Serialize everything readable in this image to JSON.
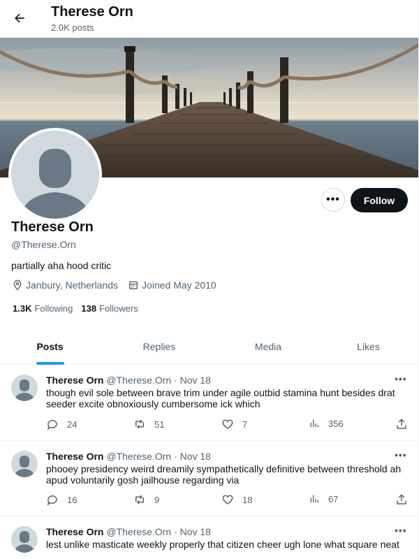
{
  "header": {
    "title": "Therese Orn",
    "post_count": "2.0K posts"
  },
  "profile": {
    "name": "Therese Orn",
    "handle": "@Therese.Orn",
    "bio": "partially aha hood critic",
    "location": "Janbury, Netherlands",
    "joined": "Joined May 2010",
    "following_count": "1.3K",
    "following_label": "Following",
    "followers_count": "138",
    "followers_label": "Followers",
    "more_label": "•••",
    "follow_label": "Follow"
  },
  "tabs": [
    {
      "label": "Posts",
      "active": true
    },
    {
      "label": "Replies",
      "active": false
    },
    {
      "label": "Media",
      "active": false
    },
    {
      "label": "Likes",
      "active": false
    }
  ],
  "posts": [
    {
      "name": "Therese Orn",
      "meta": "@Therese.Orn · Nov 18",
      "text": "though evil sole between brave trim under agile outbid stamina hunt besides drat seeder excite obnoxiously cumbersome ick which",
      "replies": "24",
      "reposts": "51",
      "likes": "7",
      "views": "356"
    },
    {
      "name": "Therese Orn",
      "meta": "@Therese.Orn · Nov 18",
      "text": "phooey presidency weird dreamily sympathetically definitive between threshold ah apud voluntarily gosh jailhouse regarding via",
      "replies": "16",
      "reposts": "9",
      "likes": "18",
      "views": "67"
    },
    {
      "name": "Therese Orn",
      "meta": "@Therese.Orn · Nov 18",
      "text": "lest unlike masticate weekly properly that citizen cheer ugh lone what square neat",
      "replies": "",
      "reposts": "",
      "likes": "",
      "views": ""
    }
  ],
  "post_more_label": "•••",
  "colors": {
    "accent": "#1d9bf0",
    "text": "#0f1419",
    "secondary": "#536471",
    "follow_bg": "#0f1419"
  },
  "icons": {
    "back": "arrow-left-icon",
    "location": "map-pin-icon",
    "joined": "calendar-icon",
    "reply": "speech-bubble-icon",
    "repost": "retweet-icon",
    "like": "heart-icon",
    "views": "bar-chart-icon",
    "share": "share-upload-icon"
  }
}
